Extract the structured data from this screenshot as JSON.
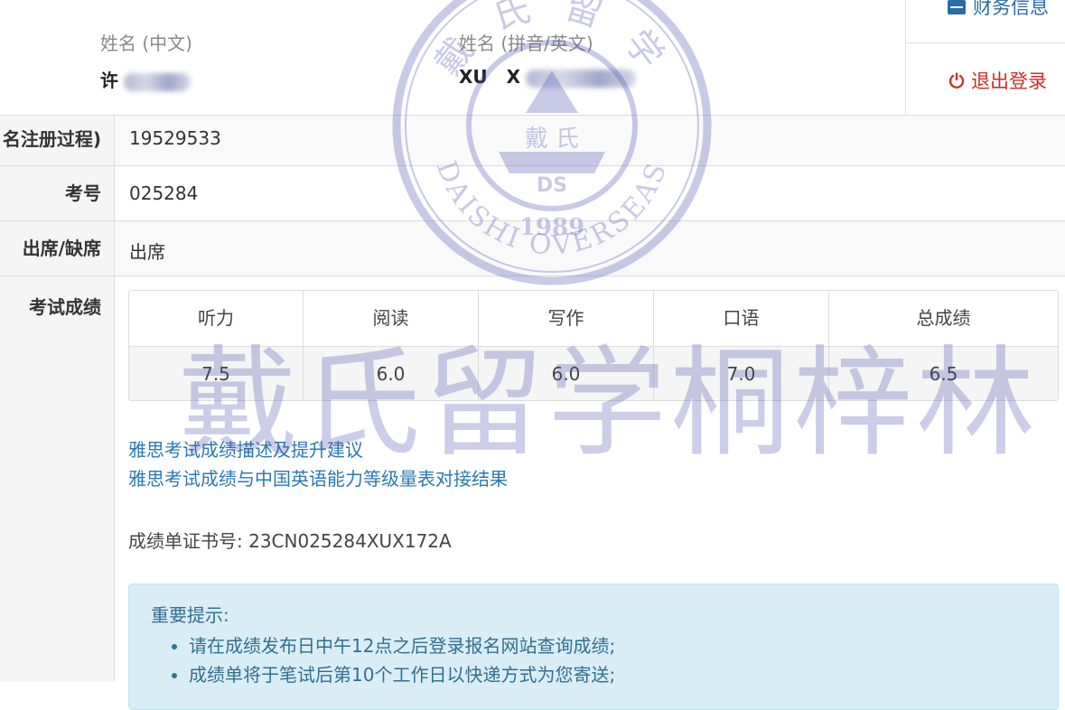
{
  "header": {
    "name_cn_label": "姓名 (中文)",
    "name_cn_value": "许",
    "name_en_label": "姓名 (拼音/英文)",
    "name_en_value": "XU",
    "name_en_partial": "X"
  },
  "side_menu": {
    "finance_label": "财务信息",
    "logout_label": "退出登录"
  },
  "rows": {
    "registration_label": "名注册过程)",
    "registration_value": "19529533",
    "exam_no_label": "考号",
    "exam_no_value": "025284",
    "attendance_label": "出席/缺席",
    "attendance_value": "出席",
    "scores_label": "考试成绩"
  },
  "scores": {
    "headers": [
      "听力",
      "阅读",
      "写作",
      "口语",
      "总成绩"
    ],
    "values": [
      "7.5",
      "6.0",
      "6.0",
      "7.0",
      "6.5"
    ]
  },
  "links": {
    "link1": "雅思考试成绩描述及提升建议",
    "link2": "雅思考试成绩与中国英语能力等级量表对接结果"
  },
  "certificate": {
    "text": "成绩单证书号: 23CN025284XUX172A"
  },
  "notice": {
    "title": "重要提示:",
    "items": [
      "请在成绩发布日中午12点之后登录报名网站查询成绩;",
      "成绩单将于笔试后第10个工作日以快递方式为您寄送;"
    ]
  },
  "watermark": {
    "text": "戴氏留学桐梓林",
    "seal_top": "戴 氏 留 学",
    "seal_center": "戴 氏",
    "seal_ds": "DS",
    "seal_year": "1989",
    "seal_bottom": "DAISHI OVERSEAS",
    "color": "#4a4fae"
  }
}
